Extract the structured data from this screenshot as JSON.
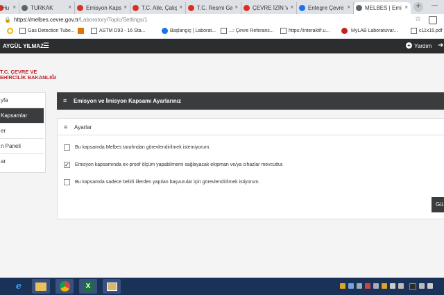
{
  "browser": {
    "tabs": [
      {
        "title": "Hu",
        "favicon_color": "#d93025"
      },
      {
        "title": "TURKAK",
        "favicon_color": "#5f6368"
      },
      {
        "title": "Emisyon Kapsa",
        "favicon_color": "#d93025"
      },
      {
        "title": "T.C. Aile, Çalışm",
        "favicon_color": "#d93025"
      },
      {
        "title": "T.C. Resmi Gaz",
        "favicon_color": "#d93025"
      },
      {
        "title": "ÇEVRE İZİN VE",
        "favicon_color": "#d93025"
      },
      {
        "title": "Entegre Çevre",
        "favicon_color": "#1a73e8"
      },
      {
        "title": "MELBES | Emi",
        "favicon_color": "#5f6368"
      }
    ],
    "close_glyph": "×",
    "new_tab_glyph": "+",
    "url_host": "https://melbes.cevre.gov.tr",
    "url_path": "/Laboratory/Topic/Settings/1",
    "bookmarks": [
      {
        "label": "",
        "icon": "circle-icon",
        "color": "#f4b400"
      },
      {
        "label": "Gas Detection Tube...",
        "icon": "page-icon",
        "color": "#5f6368"
      },
      {
        "label": "",
        "icon": "square-icon",
        "color": "#e37400"
      },
      {
        "label": "ASTM D93 - 16 Sta...",
        "icon": "page-icon",
        "color": "#5f6368"
      },
      {
        "label": "Başlangıç | Laborat...",
        "icon": "globe-icon",
        "color": "#1a73e8"
      },
      {
        "label": "...: Çevre Referans...",
        "icon": "page-icon",
        "color": "#5f6368"
      },
      {
        "label": "https://interaktif.u...",
        "icon": "page-icon",
        "color": "#5f6368"
      },
      {
        "label": "MyLAB Laboratuvar...",
        "icon": "lab-icon",
        "color": "#c5221f"
      },
      {
        "label": "c11x15.pdf",
        "icon": "pdf-icon",
        "color": "#5f6368"
      }
    ]
  },
  "header": {
    "username": "AYGÜL YILMAZ",
    "help_label": "Yardım"
  },
  "logo": {
    "line1": "T.C. ÇEVRE VE",
    "line2": "EHİRCİLİK BAKANLIĞI"
  },
  "sidebar": {
    "items": [
      {
        "label": "yfa",
        "active": false
      },
      {
        "label": "Kapsamlar",
        "active": true
      },
      {
        "label": "er",
        "active": false
      },
      {
        "label": "n Paneli",
        "active": false
      },
      {
        "label": "ar",
        "active": false
      }
    ]
  },
  "main": {
    "panel_title": "Emisyon ve İmisyon Kapsamı Ayarlarınız",
    "settings_title": "Ayarlar",
    "options": [
      {
        "label": "Bu kapsamda Melbes tarafından görevlendirilmek istemiyorum.",
        "checked": false
      },
      {
        "label": "Emisyon kapsamında ex-proof ölçüm yapabilmemi sağlayacak ekipman ve/ya cihazlar mevcuttur.",
        "checked": true
      },
      {
        "label": "Bu kapsamda sadece belirli illerden yapılan başvurular için görevlendirilmek istiyorum.",
        "checked": false
      }
    ],
    "save_label": "Gü"
  },
  "colors": {
    "header_bg": "#2b2d2f",
    "panel_dark": "#3a3c3e",
    "logo_red": "#c0202a",
    "taskbar": "#1a3158"
  }
}
